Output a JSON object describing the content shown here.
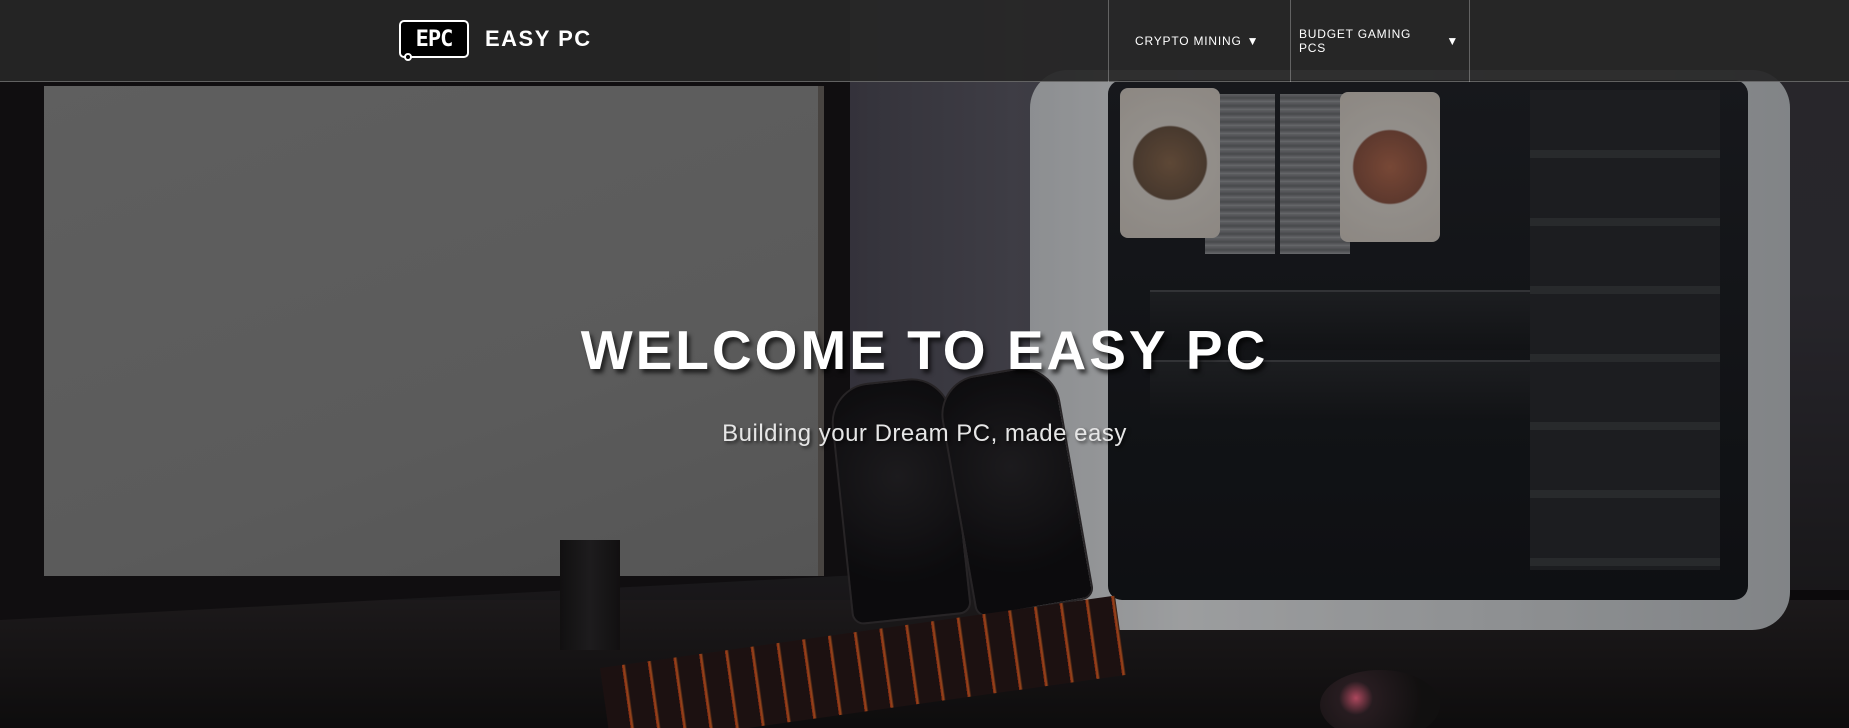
{
  "brand": {
    "logo_text": "EPC",
    "name": "EASY PC"
  },
  "nav": {
    "items": [
      {
        "label": "CRYPTO MINING",
        "caret": "▼"
      },
      {
        "label": "BUDGET GAMING PCS",
        "caret": "▼"
      }
    ]
  },
  "hero": {
    "title": "WELCOME TO EASY PC",
    "subtitle": "Building your Dream PC, made easy"
  },
  "colors": {
    "navbar": "#262626",
    "text": "#ffffff"
  }
}
